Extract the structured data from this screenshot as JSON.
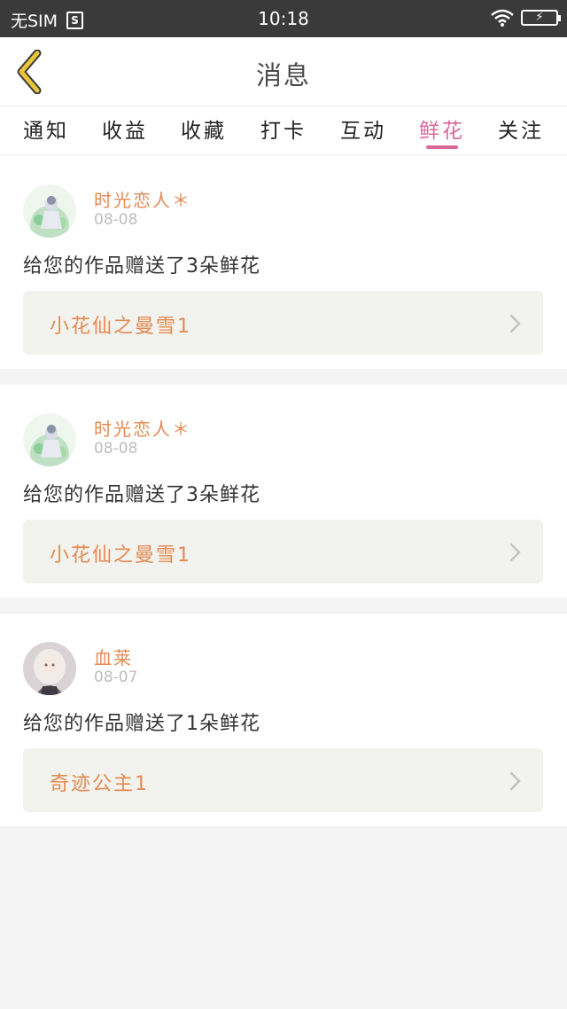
{
  "status_bar": {
    "carrier": "无SIM",
    "sim_icon_text": "S",
    "time": "10:18",
    "battery_icon": "battery-charging-icon"
  },
  "header": {
    "title": "消息",
    "back_icon": "chevron-left-icon"
  },
  "tabs": [
    {
      "label": "通知",
      "active": false
    },
    {
      "label": "收益",
      "active": false
    },
    {
      "label": "收藏",
      "active": false
    },
    {
      "label": "打卡",
      "active": false
    },
    {
      "label": "互动",
      "active": false
    },
    {
      "label": "鲜花",
      "active": true
    },
    {
      "label": "关注",
      "active": false
    }
  ],
  "notifications": [
    {
      "sender": "时光恋人＊",
      "date": "08-08",
      "message": "给您的作品赠送了3朵鲜花",
      "work_title": "小花仙之曼雪1"
    },
    {
      "sender": "时光恋人＊",
      "date": "08-08",
      "message": "给您的作品赠送了3朵鲜花",
      "work_title": "小花仙之曼雪1"
    },
    {
      "sender": "血莱",
      "date": "08-07",
      "message": "给您的作品赠送了1朵鲜花",
      "work_title": "奇迹公主1"
    }
  ],
  "colors": {
    "accent_pink": "#d9679a",
    "sender_orange": "#e48a52",
    "back_arrow_yellow": "#e9c53a"
  }
}
